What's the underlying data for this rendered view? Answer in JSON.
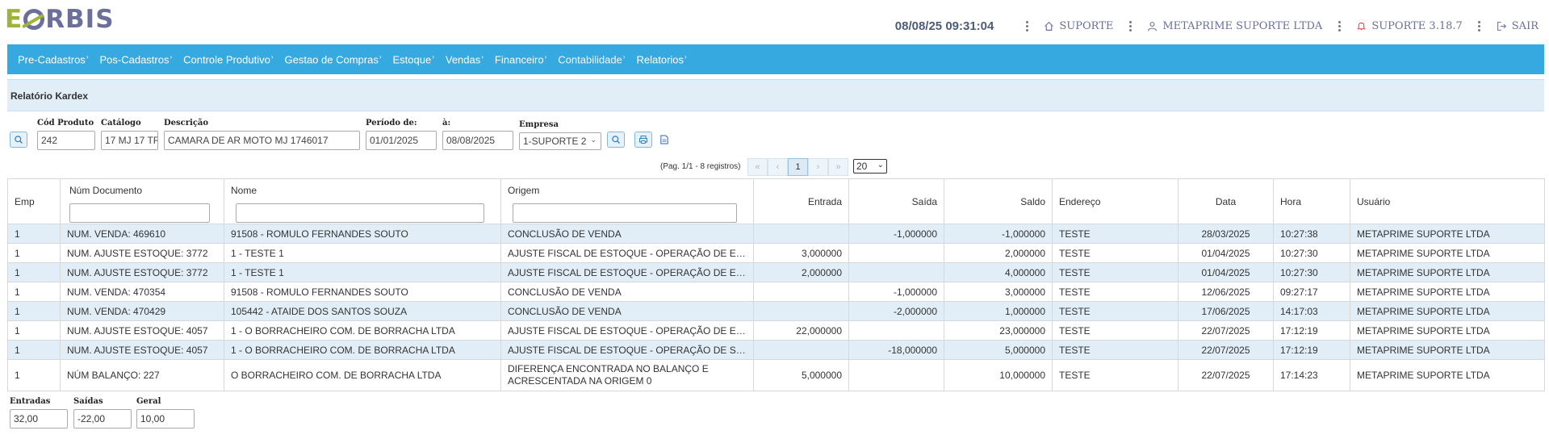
{
  "header": {
    "logo": {
      "e": "E",
      "rest": "RBIS"
    },
    "datetime": "08/08/25 09:31:04",
    "support_label": "SUPORTE",
    "company_label": "METAPRIME SUPORTE LTDA",
    "version_label": "SUPORTE 3.18.7",
    "logout_label": "SAIR"
  },
  "menu": [
    "Pre-Cadastros",
    "Pos-Cadastros",
    "Controle Produtivo",
    "Gestao de Compras",
    "Estoque",
    "Vendas",
    "Financeiro",
    "Contabilidade",
    "Relatorios"
  ],
  "section": {
    "title": "Relatório Kardex"
  },
  "filters": {
    "cod_label": "Cód Produto",
    "cod_value": "242",
    "cat_label": "Catálogo",
    "cat_value": "17 MJ 17 TR",
    "desc_label": "Descrição",
    "desc_value": "CAMARA DE AR MOTO MJ 1746017",
    "per_label": "Período de:",
    "per_from": "01/01/2025",
    "per_to_label": "à:",
    "per_to": "08/08/2025",
    "emp_label": "Empresa",
    "emp_value": "1-SUPORTE 2"
  },
  "pager": {
    "info": "(Pag. 1/1 - 8 registros)",
    "first": "«",
    "prev": "‹",
    "current": "1",
    "next": "›",
    "last": "»",
    "page_size": "20"
  },
  "table": {
    "columns": [
      "Emp",
      "Núm Documento",
      "Nome",
      "Origem",
      "Entrada",
      "Saída",
      "Saldo",
      "Endereço",
      "Data",
      "Hora",
      "Usuário"
    ],
    "rows": [
      [
        "1",
        "NUM. VENDA: 469610",
        "91508 - ROMULO FERNANDES SOUTO",
        "CONCLUSÃO DE VENDA",
        "",
        "-1,000000",
        "-1,000000",
        "TESTE",
        "28/03/2025",
        "10:27:38",
        "METAPRIME SUPORTE LTDA"
      ],
      [
        "1",
        "NUM. AJUSTE ESTOQUE: 3772",
        "1 - TESTE 1",
        "AJUSTE FISCAL DE ESTOQUE - OPERAÇÃO DE ENTRADA",
        "3,000000",
        "",
        "2,000000",
        "TESTE",
        "01/04/2025",
        "10:27:30",
        "METAPRIME SUPORTE LTDA"
      ],
      [
        "1",
        "NUM. AJUSTE ESTOQUE: 3772",
        "1 - TESTE 1",
        "AJUSTE FISCAL DE ESTOQUE - OPERAÇÃO DE ENTRADA",
        "2,000000",
        "",
        "4,000000",
        "TESTE",
        "01/04/2025",
        "10:27:30",
        "METAPRIME SUPORTE LTDA"
      ],
      [
        "1",
        "NUM. VENDA: 470354",
        "91508 - ROMULO FERNANDES SOUTO",
        "CONCLUSÃO DE VENDA",
        "",
        "-1,000000",
        "3,000000",
        "TESTE",
        "12/06/2025",
        "09:27:17",
        "METAPRIME SUPORTE LTDA"
      ],
      [
        "1",
        "NUM. VENDA: 470429",
        "105442 - ATAIDE DOS SANTOS SOUZA",
        "CONCLUSÃO DE VENDA",
        "",
        "-2,000000",
        "1,000000",
        "TESTE",
        "17/06/2025",
        "14:17:03",
        "METAPRIME SUPORTE LTDA"
      ],
      [
        "1",
        "NUM. AJUSTE ESTOQUE: 4057",
        "1 - O BORRACHEIRO COM. DE BORRACHA LTDA",
        "AJUSTE FISCAL DE ESTOQUE - OPERAÇÃO DE ENTRADA",
        "22,000000",
        "",
        "23,000000",
        "TESTE",
        "22/07/2025",
        "17:12:19",
        "METAPRIME SUPORTE LTDA"
      ],
      [
        "1",
        "NUM. AJUSTE ESTOQUE: 4057",
        "1 - O BORRACHEIRO COM. DE BORRACHA LTDA",
        "AJUSTE FISCAL DE ESTOQUE - OPERAÇÃO DE SAÍDA",
        "",
        "-18,000000",
        "5,000000",
        "TESTE",
        "22/07/2025",
        "17:12:19",
        "METAPRIME SUPORTE LTDA"
      ],
      [
        "1",
        "NÚM BALANÇO: 227",
        "O BORRACHEIRO COM. DE BORRACHA LTDA",
        "DIFERENÇA ENCONTRADA NO BALANÇO E ACRESCENTADA NA ORIGEM 0",
        "5,000000",
        "",
        "10,000000",
        "TESTE",
        "22/07/2025",
        "17:14:23",
        "METAPRIME SUPORTE LTDA"
      ]
    ]
  },
  "totals": {
    "entradas_label": "Entradas",
    "entradas_value": "32,00",
    "saidas_label": "Saídas",
    "saidas_value": "-22,00",
    "geral_label": "Geral",
    "geral_value": "10,00"
  },
  "colors": {
    "menu_bg": "#36a9e1",
    "row_alt": "#e1eef8",
    "section_bg": "#e1eef8"
  }
}
